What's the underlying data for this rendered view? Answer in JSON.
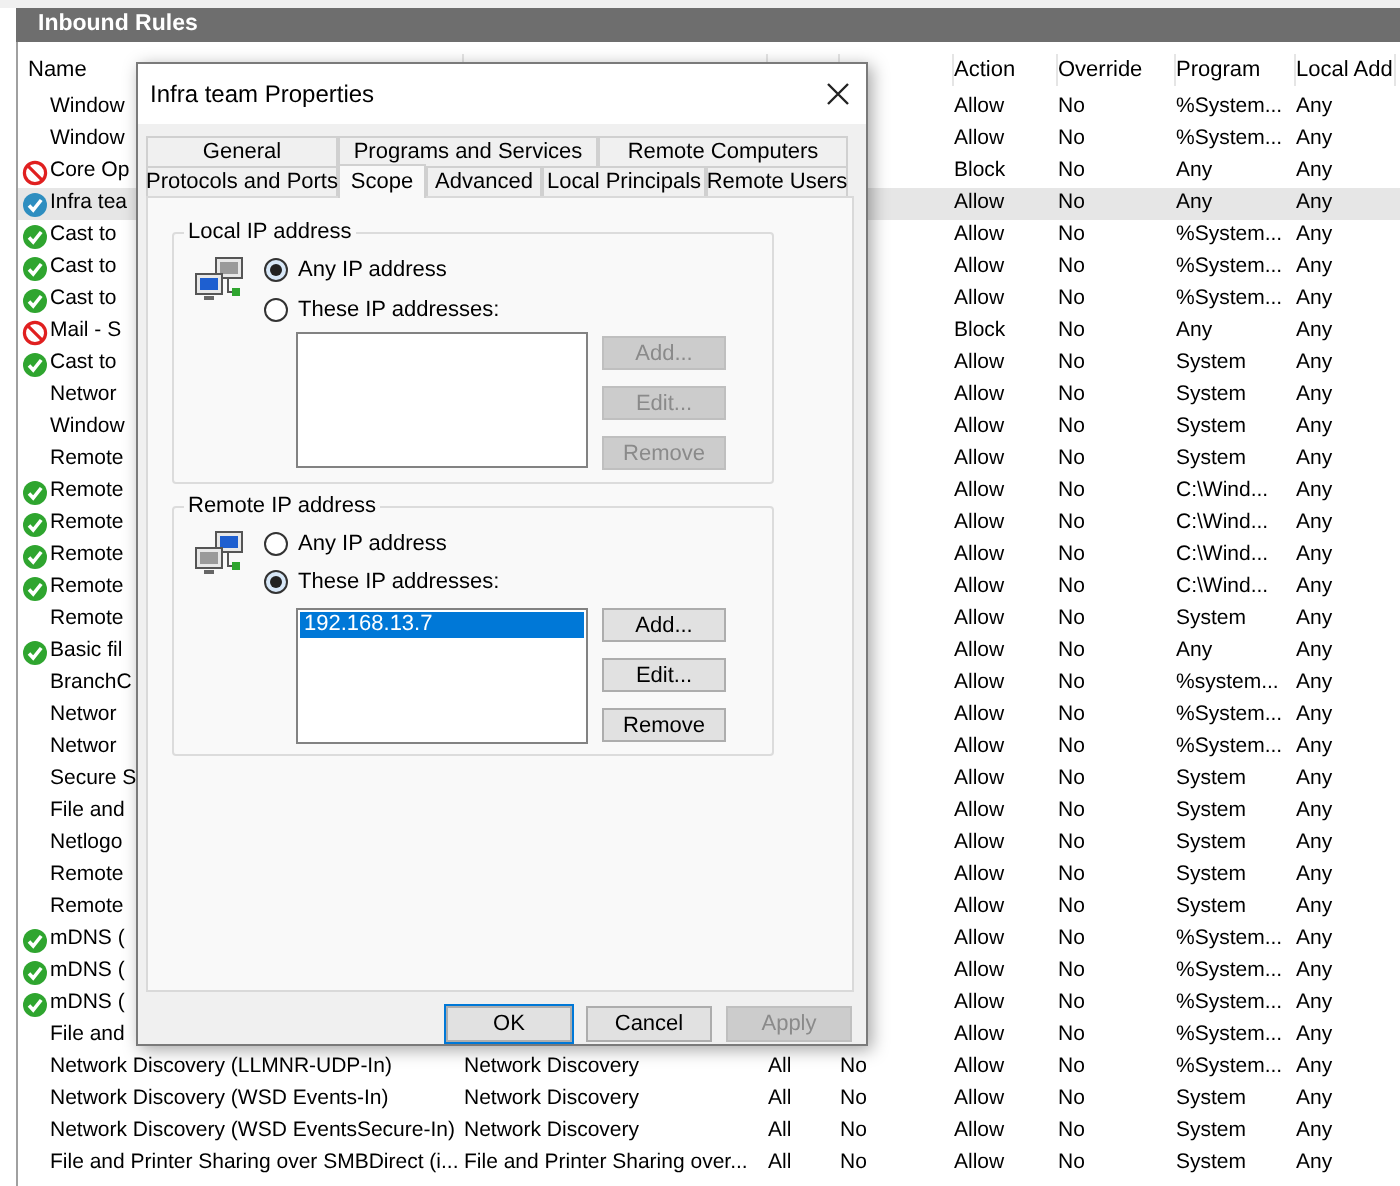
{
  "window": {
    "title": "Inbound Rules"
  },
  "table": {
    "columns": {
      "name": "Name",
      "action": "Action",
      "override": "Override",
      "program": "Program",
      "local_address": "Local Add"
    },
    "rows": [
      {
        "kind": "plain",
        "name": "Window",
        "action": "Allow",
        "override": "No",
        "program": "%System...",
        "local_address": "Any",
        "selected": false
      },
      {
        "kind": "plain",
        "name": "Window",
        "action": "Allow",
        "override": "No",
        "program": "%System...",
        "local_address": "Any",
        "selected": false
      },
      {
        "kind": "block",
        "name": "Core Op",
        "action": "Block",
        "override": "No",
        "program": "Any",
        "local_address": "Any",
        "selected": false
      },
      {
        "kind": "allow",
        "name": "Infra tea",
        "action": "Allow",
        "override": "No",
        "program": "Any",
        "local_address": "Any",
        "selected": true
      },
      {
        "kind": "allow",
        "name": "Cast to",
        "action": "Allow",
        "override": "No",
        "program": "%System...",
        "local_address": "Any",
        "selected": false
      },
      {
        "kind": "allow",
        "name": "Cast to",
        "action": "Allow",
        "override": "No",
        "program": "%System...",
        "local_address": "Any",
        "selected": false
      },
      {
        "kind": "allow",
        "name": "Cast to",
        "action": "Allow",
        "override": "No",
        "program": "%System...",
        "local_address": "Any",
        "selected": false
      },
      {
        "kind": "block",
        "name": "Mail - S",
        "action": "Block",
        "override": "No",
        "program": "Any",
        "local_address": "Any",
        "selected": false
      },
      {
        "kind": "allow",
        "name": "Cast to",
        "action": "Allow",
        "override": "No",
        "program": "System",
        "local_address": "Any",
        "selected": false
      },
      {
        "kind": "plain",
        "name": "Networ",
        "action": "Allow",
        "override": "No",
        "program": "System",
        "local_address": "Any",
        "selected": false
      },
      {
        "kind": "plain",
        "name": "Window",
        "action": "Allow",
        "override": "No",
        "program": "System",
        "local_address": "Any",
        "selected": false
      },
      {
        "kind": "plain",
        "name": "Remote",
        "action": "Allow",
        "override": "No",
        "program": "System",
        "local_address": "Any",
        "selected": false
      },
      {
        "kind": "allow",
        "name": "Remote",
        "action": "Allow",
        "override": "No",
        "program": "C:\\Wind...",
        "local_address": "Any",
        "selected": false
      },
      {
        "kind": "allow",
        "name": "Remote",
        "action": "Allow",
        "override": "No",
        "program": "C:\\Wind...",
        "local_address": "Any",
        "selected": false
      },
      {
        "kind": "allow",
        "name": "Remote",
        "action": "Allow",
        "override": "No",
        "program": "C:\\Wind...",
        "local_address": "Any",
        "selected": false
      },
      {
        "kind": "allow",
        "name": "Remote",
        "action": "Allow",
        "override": "No",
        "program": "C:\\Wind...",
        "local_address": "Any",
        "selected": false
      },
      {
        "kind": "plain",
        "name": "Remote",
        "action": "Allow",
        "override": "No",
        "program": "System",
        "local_address": "Any",
        "selected": false
      },
      {
        "kind": "allow",
        "name": "Basic fil",
        "action": "Allow",
        "override": "No",
        "program": "Any",
        "local_address": "Any",
        "selected": false
      },
      {
        "kind": "plain",
        "name": "BranchC",
        "action": "Allow",
        "override": "No",
        "program": "%system...",
        "local_address": "Any",
        "selected": false
      },
      {
        "kind": "plain",
        "name": "Networ",
        "action": "Allow",
        "override": "No",
        "program": "%System...",
        "local_address": "Any",
        "selected": false
      },
      {
        "kind": "plain",
        "name": "Networ",
        "action": "Allow",
        "override": "No",
        "program": "%System...",
        "local_address": "Any",
        "selected": false
      },
      {
        "kind": "plain",
        "name": "Secure S",
        "action": "Allow",
        "override": "No",
        "program": "System",
        "local_address": "Any",
        "selected": false
      },
      {
        "kind": "plain",
        "name": "File and",
        "action": "Allow",
        "override": "No",
        "program": "System",
        "local_address": "Any",
        "selected": false
      },
      {
        "kind": "plain",
        "name": "Netlogo",
        "action": "Allow",
        "override": "No",
        "program": "System",
        "local_address": "Any",
        "selected": false
      },
      {
        "kind": "plain",
        "name": "Remote",
        "action": "Allow",
        "override": "No",
        "program": "System",
        "local_address": "Any",
        "selected": false
      },
      {
        "kind": "plain",
        "name": "Remote",
        "action": "Allow",
        "override": "No",
        "program": "System",
        "local_address": "Any",
        "selected": false
      },
      {
        "kind": "allow",
        "name": "mDNS (",
        "action": "Allow",
        "override": "No",
        "program": "%System...",
        "local_address": "Any",
        "selected": false
      },
      {
        "kind": "allow",
        "name": "mDNS (",
        "action": "Allow",
        "override": "No",
        "program": "%System...",
        "local_address": "Any",
        "selected": false
      },
      {
        "kind": "allow",
        "name": "mDNS (",
        "action": "Allow",
        "override": "No",
        "program": "%System...",
        "local_address": "Any",
        "selected": false
      },
      {
        "kind": "plain",
        "name": "File and",
        "action": "Allow",
        "override": "No",
        "program": "%System...",
        "local_address": "Any",
        "selected": false
      },
      {
        "kind": "plain",
        "name": "Network Discovery (LLMNR-UDP-In)",
        "group": "Network Discovery",
        "profile": "All",
        "enabled": "No",
        "action": "Allow",
        "override": "No",
        "program": "%System...",
        "local_address": "Any",
        "selected": false
      },
      {
        "kind": "plain",
        "name": "Network Discovery (WSD Events-In)",
        "group": "Network Discovery",
        "profile": "All",
        "enabled": "No",
        "action": "Allow",
        "override": "No",
        "program": "System",
        "local_address": "Any",
        "selected": false
      },
      {
        "kind": "plain",
        "name": "Network Discovery (WSD EventsSecure-In)",
        "group": "Network Discovery",
        "profile": "All",
        "enabled": "No",
        "action": "Allow",
        "override": "No",
        "program": "System",
        "local_address": "Any",
        "selected": false
      },
      {
        "kind": "plain",
        "name": "File and Printer Sharing over SMBDirect (i...",
        "group": "File and Printer Sharing over...",
        "profile": "All",
        "enabled": "No",
        "action": "Allow",
        "override": "No",
        "program": "System",
        "local_address": "Any",
        "selected": false
      }
    ]
  },
  "dialog": {
    "title": "Infra team Properties",
    "tab_rows": [
      [
        {
          "label": "General",
          "selected": false
        },
        {
          "label": "Programs and Services",
          "selected": false
        },
        {
          "label": "Remote Computers",
          "selected": false
        }
      ],
      [
        {
          "label": "Protocols and Ports",
          "selected": false
        },
        {
          "label": "Scope",
          "selected": true
        },
        {
          "label": "Advanced",
          "selected": false
        },
        {
          "label": "Local Principals",
          "selected": false
        },
        {
          "label": "Remote Users",
          "selected": false
        }
      ]
    ],
    "groups": [
      {
        "title": "Local IP address",
        "options": [
          {
            "label": "Any IP address",
            "selected": true
          },
          {
            "label": "These IP addresses:",
            "selected": false
          }
        ],
        "buttons": [
          {
            "label": "Add...",
            "disabled": true
          },
          {
            "label": "Edit...",
            "disabled": true
          },
          {
            "label": "Remove",
            "disabled": true
          }
        ]
      },
      {
        "title": "Remote IP address",
        "options": [
          {
            "label": "Any IP address",
            "selected": false
          },
          {
            "label": "These IP addresses:",
            "selected": true
          }
        ],
        "addresses": [
          {
            "text": "192.168.13.7",
            "selected": true
          }
        ],
        "buttons": [
          {
            "label": "Add...",
            "disabled": false
          },
          {
            "label": "Edit...",
            "disabled": false
          },
          {
            "label": "Remove",
            "disabled": false
          }
        ]
      }
    ],
    "buttons": [
      {
        "label": "OK",
        "default": true,
        "disabled": false
      },
      {
        "label": "Cancel",
        "default": false,
        "disabled": false
      },
      {
        "label": "Apply",
        "default": false,
        "disabled": true
      }
    ]
  }
}
